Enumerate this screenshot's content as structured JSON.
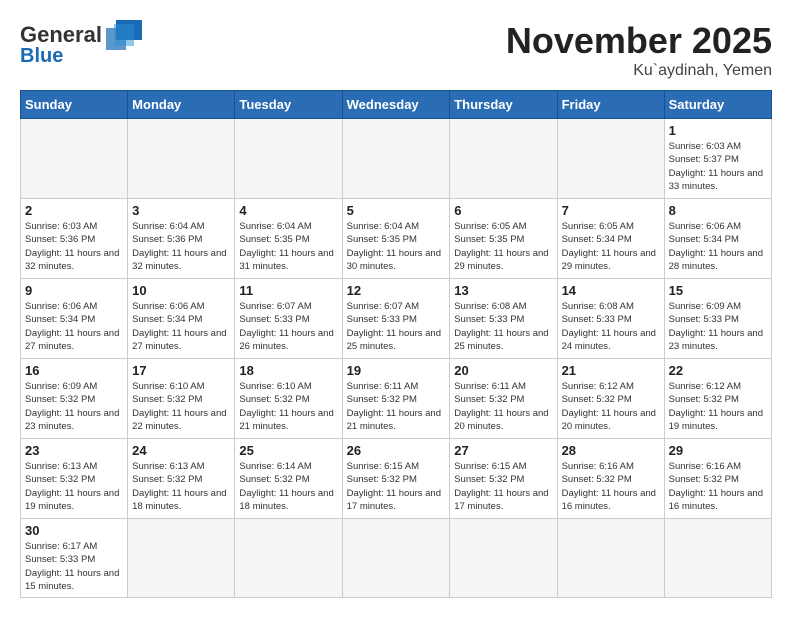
{
  "header": {
    "logo_general": "General",
    "logo_blue": "Blue",
    "month_title": "November 2025",
    "location": "Ku`aydinah, Yemen"
  },
  "days_of_week": [
    "Sunday",
    "Monday",
    "Tuesday",
    "Wednesday",
    "Thursday",
    "Friday",
    "Saturday"
  ],
  "weeks": [
    [
      {
        "day": "",
        "info": ""
      },
      {
        "day": "",
        "info": ""
      },
      {
        "day": "",
        "info": ""
      },
      {
        "day": "",
        "info": ""
      },
      {
        "day": "",
        "info": ""
      },
      {
        "day": "",
        "info": ""
      },
      {
        "day": "1",
        "info": "Sunrise: 6:03 AM\nSunset: 5:37 PM\nDaylight: 11 hours\nand 33 minutes."
      }
    ],
    [
      {
        "day": "2",
        "info": "Sunrise: 6:03 AM\nSunset: 5:36 PM\nDaylight: 11 hours\nand 32 minutes."
      },
      {
        "day": "3",
        "info": "Sunrise: 6:04 AM\nSunset: 5:36 PM\nDaylight: 11 hours\nand 32 minutes."
      },
      {
        "day": "4",
        "info": "Sunrise: 6:04 AM\nSunset: 5:35 PM\nDaylight: 11 hours\nand 31 minutes."
      },
      {
        "day": "5",
        "info": "Sunrise: 6:04 AM\nSunset: 5:35 PM\nDaylight: 11 hours\nand 30 minutes."
      },
      {
        "day": "6",
        "info": "Sunrise: 6:05 AM\nSunset: 5:35 PM\nDaylight: 11 hours\nand 29 minutes."
      },
      {
        "day": "7",
        "info": "Sunrise: 6:05 AM\nSunset: 5:34 PM\nDaylight: 11 hours\nand 29 minutes."
      },
      {
        "day": "8",
        "info": "Sunrise: 6:06 AM\nSunset: 5:34 PM\nDaylight: 11 hours\nand 28 minutes."
      }
    ],
    [
      {
        "day": "9",
        "info": "Sunrise: 6:06 AM\nSunset: 5:34 PM\nDaylight: 11 hours\nand 27 minutes."
      },
      {
        "day": "10",
        "info": "Sunrise: 6:06 AM\nSunset: 5:34 PM\nDaylight: 11 hours\nand 27 minutes."
      },
      {
        "day": "11",
        "info": "Sunrise: 6:07 AM\nSunset: 5:33 PM\nDaylight: 11 hours\nand 26 minutes."
      },
      {
        "day": "12",
        "info": "Sunrise: 6:07 AM\nSunset: 5:33 PM\nDaylight: 11 hours\nand 25 minutes."
      },
      {
        "day": "13",
        "info": "Sunrise: 6:08 AM\nSunset: 5:33 PM\nDaylight: 11 hours\nand 25 minutes."
      },
      {
        "day": "14",
        "info": "Sunrise: 6:08 AM\nSunset: 5:33 PM\nDaylight: 11 hours\nand 24 minutes."
      },
      {
        "day": "15",
        "info": "Sunrise: 6:09 AM\nSunset: 5:33 PM\nDaylight: 11 hours\nand 23 minutes."
      }
    ],
    [
      {
        "day": "16",
        "info": "Sunrise: 6:09 AM\nSunset: 5:32 PM\nDaylight: 11 hours\nand 23 minutes."
      },
      {
        "day": "17",
        "info": "Sunrise: 6:10 AM\nSunset: 5:32 PM\nDaylight: 11 hours\nand 22 minutes."
      },
      {
        "day": "18",
        "info": "Sunrise: 6:10 AM\nSunset: 5:32 PM\nDaylight: 11 hours\nand 21 minutes."
      },
      {
        "day": "19",
        "info": "Sunrise: 6:11 AM\nSunset: 5:32 PM\nDaylight: 11 hours\nand 21 minutes."
      },
      {
        "day": "20",
        "info": "Sunrise: 6:11 AM\nSunset: 5:32 PM\nDaylight: 11 hours\nand 20 minutes."
      },
      {
        "day": "21",
        "info": "Sunrise: 6:12 AM\nSunset: 5:32 PM\nDaylight: 11 hours\nand 20 minutes."
      },
      {
        "day": "22",
        "info": "Sunrise: 6:12 AM\nSunset: 5:32 PM\nDaylight: 11 hours\nand 19 minutes."
      }
    ],
    [
      {
        "day": "23",
        "info": "Sunrise: 6:13 AM\nSunset: 5:32 PM\nDaylight: 11 hours\nand 19 minutes."
      },
      {
        "day": "24",
        "info": "Sunrise: 6:13 AM\nSunset: 5:32 PM\nDaylight: 11 hours\nand 18 minutes."
      },
      {
        "day": "25",
        "info": "Sunrise: 6:14 AM\nSunset: 5:32 PM\nDaylight: 11 hours\nand 18 minutes."
      },
      {
        "day": "26",
        "info": "Sunrise: 6:15 AM\nSunset: 5:32 PM\nDaylight: 11 hours\nand 17 minutes."
      },
      {
        "day": "27",
        "info": "Sunrise: 6:15 AM\nSunset: 5:32 PM\nDaylight: 11 hours\nand 17 minutes."
      },
      {
        "day": "28",
        "info": "Sunrise: 6:16 AM\nSunset: 5:32 PM\nDaylight: 11 hours\nand 16 minutes."
      },
      {
        "day": "29",
        "info": "Sunrise: 6:16 AM\nSunset: 5:32 PM\nDaylight: 11 hours\nand 16 minutes."
      }
    ],
    [
      {
        "day": "30",
        "info": "Sunrise: 6:17 AM\nSunset: 5:33 PM\nDaylight: 11 hours\nand 15 minutes."
      },
      {
        "day": "",
        "info": ""
      },
      {
        "day": "",
        "info": ""
      },
      {
        "day": "",
        "info": ""
      },
      {
        "day": "",
        "info": ""
      },
      {
        "day": "",
        "info": ""
      },
      {
        "day": "",
        "info": ""
      }
    ]
  ]
}
